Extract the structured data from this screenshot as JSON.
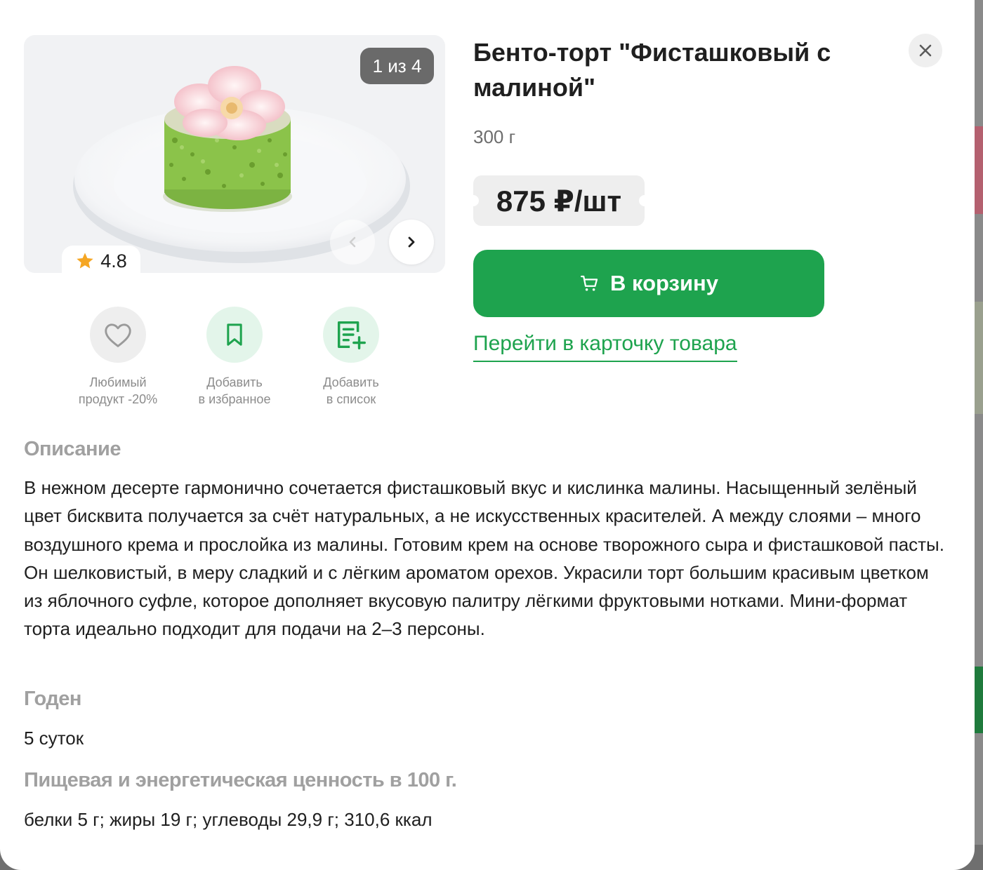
{
  "gallery": {
    "counter": "1 из 4",
    "rating": "4.8"
  },
  "actions": [
    {
      "label_line1": "Любимый",
      "label_line2": "продукт -20%"
    },
    {
      "label_line1": "Добавить",
      "label_line2": "в избранное"
    },
    {
      "label_line1": "Добавить",
      "label_line2": "в список"
    }
  ],
  "product": {
    "title": "Бенто-торт \"Фисташковый с малиной\"",
    "weight": "300 г",
    "price": "875 ₽/шт",
    "cart_button": "В корзину",
    "product_link": "Перейти в карточку товара"
  },
  "description": {
    "heading": "Описание",
    "text": "В нежном десерте гармонично сочетается фисташковый вкус и кислинка малины. Насыщенный зелёный цвет бисквита получается за счёт натуральных, а не искусственных красителей. А между слоями – много воздушного крема и прослойка из малины. Готовим крем на основе творожного сыра и фисташковой пасты. Он шелковистый, в меру сладкий и с лёгким ароматом орехов. Украсили торт большим красивым цветком из яблочного суфле, которое дополняет вкусовую палитру лёгкими фруктовыми нотками. Мини-формат торта идеально подходит для подачи на 2–3 персоны."
  },
  "shelf_life": {
    "heading": "Годен",
    "value": "5 суток"
  },
  "nutrition": {
    "heading": "Пищевая и энергетическая ценность в 100 г.",
    "value": "белки 5 г; жиры 19 г; углеводы 29,9 г; 310,6 ккал"
  },
  "colors": {
    "accent_green": "#1ea34e",
    "light_green": "#e3f5ea",
    "star": "#f5a623"
  },
  "icons": [
    "close-icon",
    "chevron-left-icon",
    "chevron-right-icon",
    "star-icon",
    "heart-icon",
    "bookmark-icon",
    "list-add-icon",
    "cart-icon"
  ]
}
